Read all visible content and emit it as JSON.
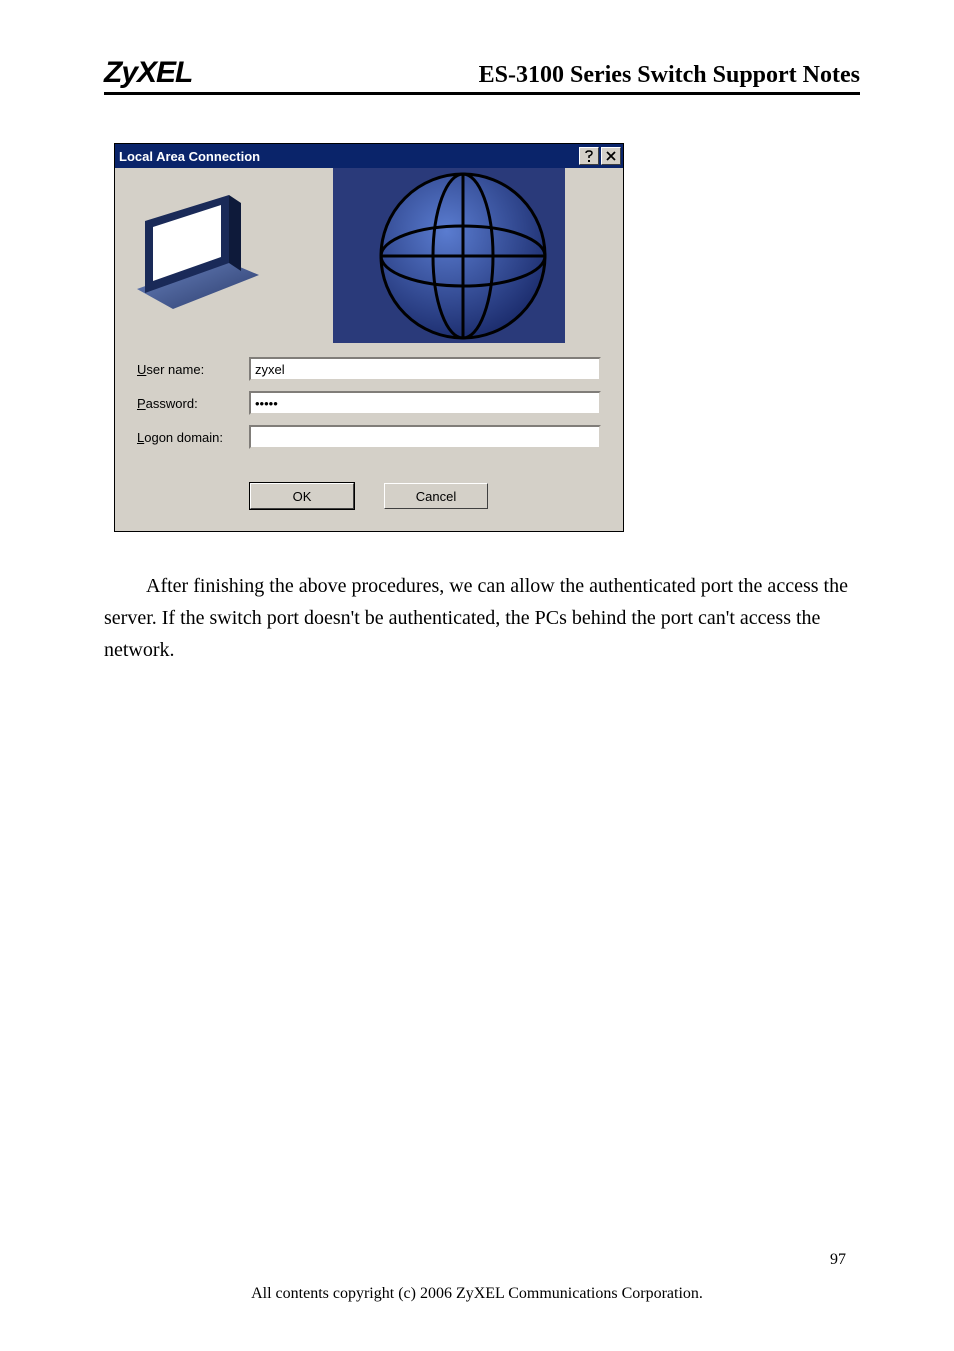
{
  "header": {
    "logo": "ZyXEL",
    "title": "ES-3100 Series Switch Support Notes"
  },
  "dialog": {
    "title": "Local Area Connection",
    "fields": {
      "username_label_u": "U",
      "username_label_rest": "ser name:",
      "username_value": "zyxel",
      "password_label_p": "P",
      "password_label_rest": "assword:",
      "password_value": "•••••",
      "logon_label_l": "L",
      "logon_label_rest": "ogon domain:",
      "logon_value": ""
    },
    "buttons": {
      "ok": "OK",
      "cancel": "Cancel"
    }
  },
  "body_text": "After finishing the above procedures, we can allow the authenticated port the access the server. If the switch port doesn't be authenticated, the PCs behind the port can't access the network.",
  "footer": "All contents copyright (c) 2006 ZyXEL Communications Corporation.",
  "page_number": "97"
}
